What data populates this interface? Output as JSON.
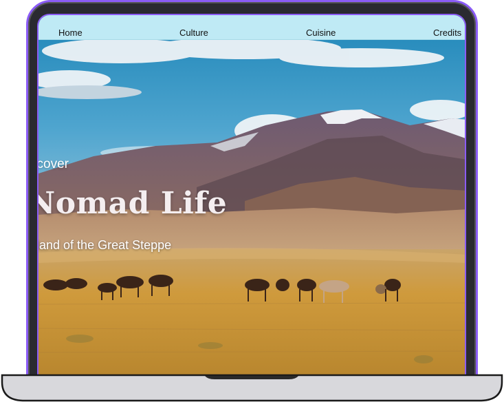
{
  "nav": {
    "items": [
      {
        "label": "Home"
      },
      {
        "label": "Culture"
      },
      {
        "label": "Cuisine"
      },
      {
        "label": "Credits"
      }
    ]
  },
  "hero": {
    "eyebrow": "scover",
    "title": "Nomad Life",
    "subtitle": "e land of the Great Steppe",
    "image": "steppe-mountains-horses-photo"
  },
  "colors": {
    "frame_accent": "#8b5cf6",
    "nav_background": "#bfeaf5",
    "sky": "#3f9cc8",
    "steppe": "#c9923a"
  }
}
